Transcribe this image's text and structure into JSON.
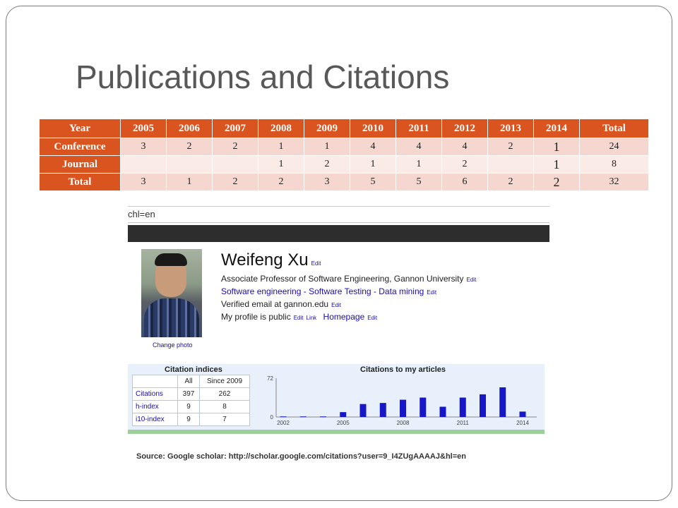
{
  "slide": {
    "title": "Publications and Citations"
  },
  "table": {
    "header": [
      "Year",
      "2005",
      "2006",
      "2007",
      "2008",
      "2009",
      "2010",
      "2011",
      "2012",
      "2013",
      "2014",
      "Total"
    ],
    "rows": [
      {
        "label": "Conference",
        "cells": [
          "3",
          "2",
          "2",
          "1",
          "1",
          "4",
          "4",
          "4",
          "2",
          "1",
          "24"
        ]
      },
      {
        "label": "Journal",
        "cells": [
          "",
          "",
          "",
          "1",
          "2",
          "1",
          "1",
          "2",
          "",
          "1",
          "8"
        ]
      },
      {
        "label": "Total",
        "cells": [
          "3",
          "1",
          "2",
          "2",
          "3",
          "5",
          "5",
          "6",
          "2",
          "2",
          "32"
        ]
      }
    ]
  },
  "screenshot": {
    "url_fragment": "chl=en",
    "profile": {
      "name": "Weifeng Xu",
      "edit": "Edit",
      "link": "Link",
      "affiliation": "Associate Professor of Software Engineering, Gannon University",
      "interests": [
        "Software engineering",
        "Software Testing",
        "Data mining"
      ],
      "interest_sep": " - ",
      "email": "Verified email at gannon.edu",
      "public_text": "My profile is public",
      "homepage": "Homepage",
      "change_photo": "Change photo"
    },
    "citation_indices": {
      "title": "Citation indices",
      "columns": [
        "",
        "All",
        "Since 2009"
      ],
      "rows": [
        {
          "label": "Citations",
          "all": "397",
          "since": "262"
        },
        {
          "label": "h-index",
          "all": "9",
          "since": "8"
        },
        {
          "label": "i10-index",
          "all": "9",
          "since": "7"
        }
      ]
    },
    "citations_chart_title": "Citations to my articles"
  },
  "chart_data": {
    "type": "bar",
    "title": "Citations to my articles",
    "x": [
      2002,
      2003,
      2004,
      2005,
      2006,
      2007,
      2008,
      2009,
      2010,
      2011,
      2012,
      2013,
      2014
    ],
    "values": [
      1,
      1,
      1,
      9,
      24,
      26,
      32,
      36,
      19,
      36,
      42,
      55,
      10
    ],
    "xticks": [
      "2002",
      "2005",
      "2008",
      "2011",
      "2014"
    ],
    "yticks": [
      "0",
      "72"
    ],
    "ylim": [
      0,
      72
    ],
    "bar_color": "#1717c8"
  },
  "source": "Source: Google scholar: http://scholar.google.com/citations?user=9_I4ZUgAAAAJ&hl=en"
}
